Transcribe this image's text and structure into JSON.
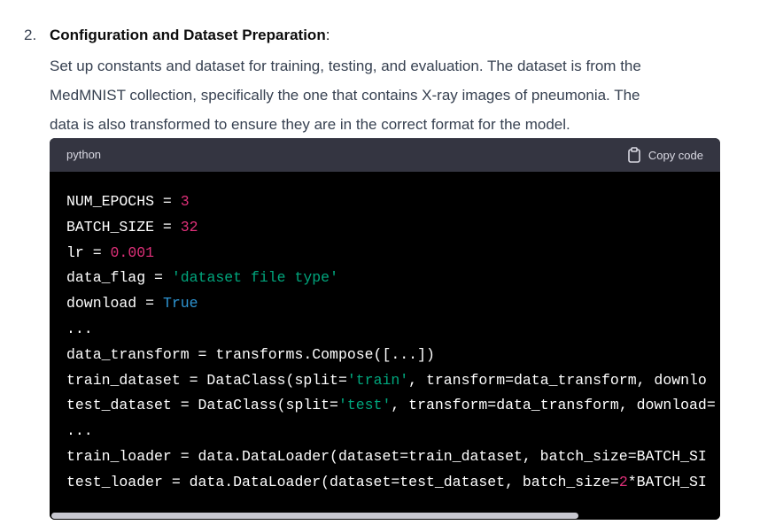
{
  "list": {
    "number": "2.",
    "heading_bold": "Configuration and Dataset Preparation",
    "heading_suffix": ":",
    "paragraph_lines": [
      "Set up constants and dataset for training, testing, and evaluation. The dataset is from the",
      "MedMNIST collection, specifically the one that contains X-ray images of pneumonia. The",
      "data is also transformed to ensure they are in the correct format for the model."
    ]
  },
  "code": {
    "language": "python",
    "copy_label": "Copy code",
    "copy_icon": "clipboard-icon",
    "colors": {
      "background": "#000000",
      "header_background": "#343541",
      "number": "#df3079",
      "string": "#00a67d",
      "keyword": "#2e95d3",
      "text": "#ffffff"
    },
    "lines": [
      [
        {
          "t": "NUM_EPOCHS "
        },
        {
          "t": "= "
        },
        {
          "t": "3",
          "c": "num"
        }
      ],
      [
        {
          "t": "BATCH_SIZE "
        },
        {
          "t": "= "
        },
        {
          "t": "32",
          "c": "num"
        }
      ],
      [
        {
          "t": "lr "
        },
        {
          "t": "= "
        },
        {
          "t": "0.001",
          "c": "num"
        }
      ],
      [
        {
          "t": "data_flag "
        },
        {
          "t": "= "
        },
        {
          "t": "'dataset file type'",
          "c": "str"
        }
      ],
      [
        {
          "t": "download "
        },
        {
          "t": "= "
        },
        {
          "t": "True",
          "c": "kw"
        }
      ],
      [
        {
          "t": "..."
        }
      ],
      [
        {
          "t": "data_transform = transforms.Compose([...])"
        }
      ],
      [
        {
          "t": "train_dataset = DataClass(split="
        },
        {
          "t": "'train'",
          "c": "str"
        },
        {
          "t": ", transform=data_transform, downlo"
        }
      ],
      [
        {
          "t": "test_dataset = DataClass(split="
        },
        {
          "t": "'test'",
          "c": "str"
        },
        {
          "t": ", transform=data_transform, download="
        }
      ],
      [
        {
          "t": "..."
        }
      ],
      [
        {
          "t": "train_loader = data.DataLoader(dataset=train_dataset, batch_size=BATCH_SI"
        }
      ],
      [
        {
          "t": "test_loader = data.DataLoader(dataset=test_dataset, batch_size="
        },
        {
          "t": "2",
          "c": "num"
        },
        {
          "t": "*BATCH_SI"
        }
      ]
    ],
    "horizontal_scroll_fraction": 0.79
  }
}
